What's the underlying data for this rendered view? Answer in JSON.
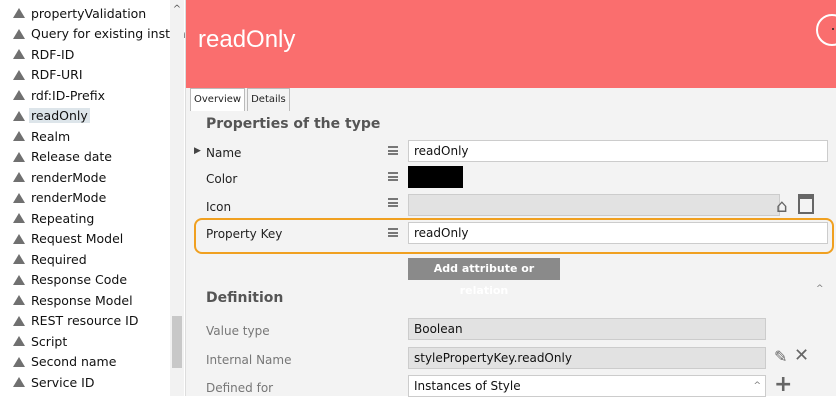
{
  "tree": {
    "items": [
      {
        "label": "propertyValidation"
      },
      {
        "label": "Query for existing instances"
      },
      {
        "label": "RDF-ID"
      },
      {
        "label": "RDF-URI"
      },
      {
        "label": "rdf:ID-Prefix"
      },
      {
        "label": "readOnly"
      },
      {
        "label": "Realm"
      },
      {
        "label": "Release date"
      },
      {
        "label": "renderMode"
      },
      {
        "label": "renderMode"
      },
      {
        "label": "Repeating"
      },
      {
        "label": "Request Model"
      },
      {
        "label": "Required"
      },
      {
        "label": "Response Code"
      },
      {
        "label": "Response Model"
      },
      {
        "label": "REST resource ID"
      },
      {
        "label": "Script"
      },
      {
        "label": "Second name"
      },
      {
        "label": "Service ID"
      }
    ],
    "selected_index": 5
  },
  "header": {
    "title": "readOnly"
  },
  "tabs": [
    {
      "label": "Overview"
    },
    {
      "label": "Details"
    }
  ],
  "properties": {
    "section_title": "Properties of the type",
    "name": {
      "label": "Name",
      "value": "readOnly"
    },
    "color": {
      "label": "Color",
      "value": "#000000"
    },
    "icon": {
      "label": "Icon",
      "value": ""
    },
    "property_key": {
      "label": "Property Key",
      "value": "readOnly"
    },
    "add_button": "Add attribute or relation"
  },
  "definition": {
    "section_title": "Definition",
    "value_type": {
      "label": "Value type",
      "value": "Boolean"
    },
    "internal_name": {
      "label": "Internal Name",
      "value": "stylePropertyKey.readOnly"
    },
    "defined_for": {
      "label": "Defined for",
      "value": "Instances of Style"
    }
  },
  "colors": {
    "header": "#fa6e6e",
    "highlight": "#f0a020"
  }
}
